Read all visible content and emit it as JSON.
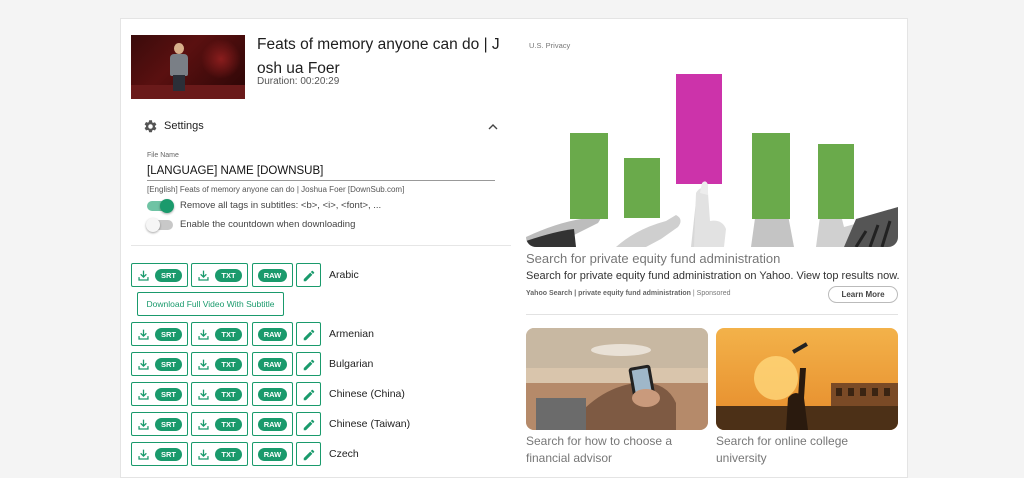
{
  "video": {
    "title": "Feats of memory anyone can do | Josh ua Foer",
    "duration": "Duration: 00:20:29"
  },
  "settings": {
    "label": "Settings",
    "file_name_label": "File Name",
    "file_name_value": "[LANGUAGE] NAME [DOWNSUB]",
    "file_name_hint": "[English] Feats of memory anyone can do | Joshua Foer [DownSub.com]",
    "toggles": [
      {
        "label": "Remove all tags in subtitles: <b>, <i>, <font>, ...",
        "on": true
      },
      {
        "label": "Enable the countdown when downloading",
        "on": false
      }
    ]
  },
  "buttons": {
    "srt": "SRT",
    "txt": "TXT",
    "raw": "RAW",
    "full_video": "Download Full Video With Subtitle"
  },
  "languages": [
    "Arabic",
    "Armenian",
    "Bulgarian",
    "Chinese (China)",
    "Chinese (Taiwan)",
    "Czech"
  ],
  "ads": {
    "privacy": "U.S. Privacy",
    "main": {
      "title": "Search for private equity fund administration",
      "description": "Search for private equity fund administration on Yahoo. View top results now.",
      "source_bold": "Yahoo Search | private equity fund administration",
      "source_suffix": " | Sponsored",
      "cta": "Learn More"
    },
    "tiles": [
      {
        "title": "Search for how to choose a financial advisor"
      },
      {
        "title": "Search for online college university"
      }
    ]
  },
  "colors": {
    "accent": "#1a9a6c",
    "bar_green": "#6aaa4b",
    "bar_magenta": "#cc33aa"
  }
}
